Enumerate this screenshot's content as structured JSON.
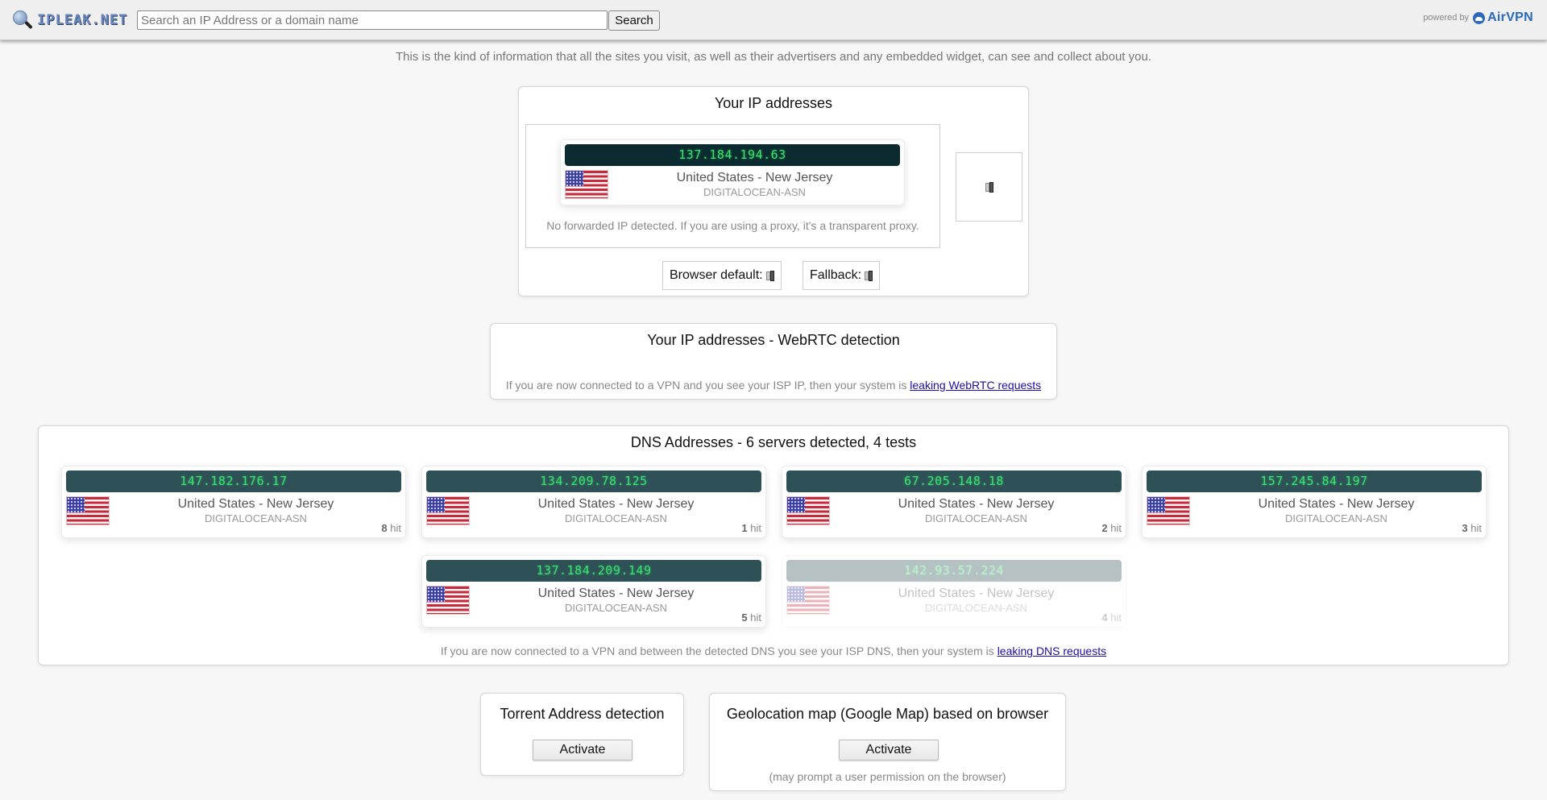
{
  "header": {
    "logo_text": "IPLEAK.NET",
    "search_placeholder": "Search an IP Address or a domain name",
    "search_value": "",
    "search_button": "Search",
    "powered_by": "powered by",
    "brand": "AirVPN",
    "brand_color": "#2a6ab8"
  },
  "intro": "This is the kind of information that all the sites you visit, as well as their advertisers and any embedded widget, can see and collect about you.",
  "your_ip": {
    "title": "Your IP addresses",
    "address": {
      "ip": "137.184.194.63",
      "location": "United States - New Jersey",
      "asn": "DIGITALOCEAN-ASN",
      "flag": "us-flag"
    },
    "forwarded_note": "No forwarded IP detected. If you are using a proxy, it's a transparent proxy.",
    "browser_default_label": "Browser default:",
    "fallback_label": "Fallback:"
  },
  "webrtc": {
    "title": "Your IP addresses - WebRTC detection",
    "note": "If you are now connected to a VPN and you see your ISP IP, then your system is",
    "link": "leaking WebRTC requests"
  },
  "dns": {
    "title": "DNS Addresses - 6 servers detected, 4 tests",
    "hit_suffix": "hit",
    "servers": [
      {
        "ip": "147.182.176.17",
        "location": "United States - New Jersey",
        "asn": "DIGITALOCEAN-ASN",
        "hits": "8"
      },
      {
        "ip": "134.209.78.125",
        "location": "United States - New Jersey",
        "asn": "DIGITALOCEAN-ASN",
        "hits": "1"
      },
      {
        "ip": "67.205.148.18",
        "location": "United States - New Jersey",
        "asn": "DIGITALOCEAN-ASN",
        "hits": "2"
      },
      {
        "ip": "157.245.84.197",
        "location": "United States - New Jersey",
        "asn": "DIGITALOCEAN-ASN",
        "hits": "3"
      },
      {
        "ip": "137.184.209.149",
        "location": "United States - New Jersey",
        "asn": "DIGITALOCEAN-ASN",
        "hits": "5"
      },
      {
        "ip": "142.93.57.224",
        "location": "United States - New Jersey",
        "asn": "DIGITALOCEAN-ASN",
        "hits": "4"
      }
    ],
    "note": "If you are now connected to a VPN and between the detected DNS you see your ISP DNS, then your system is",
    "link": "leaking DNS requests"
  },
  "torrent": {
    "title": "Torrent Address detection",
    "button": "Activate"
  },
  "geolocation": {
    "title": "Geolocation map (Google Map) based on browser",
    "button": "Activate",
    "note": "(may prompt a user permission on the browser)"
  }
}
